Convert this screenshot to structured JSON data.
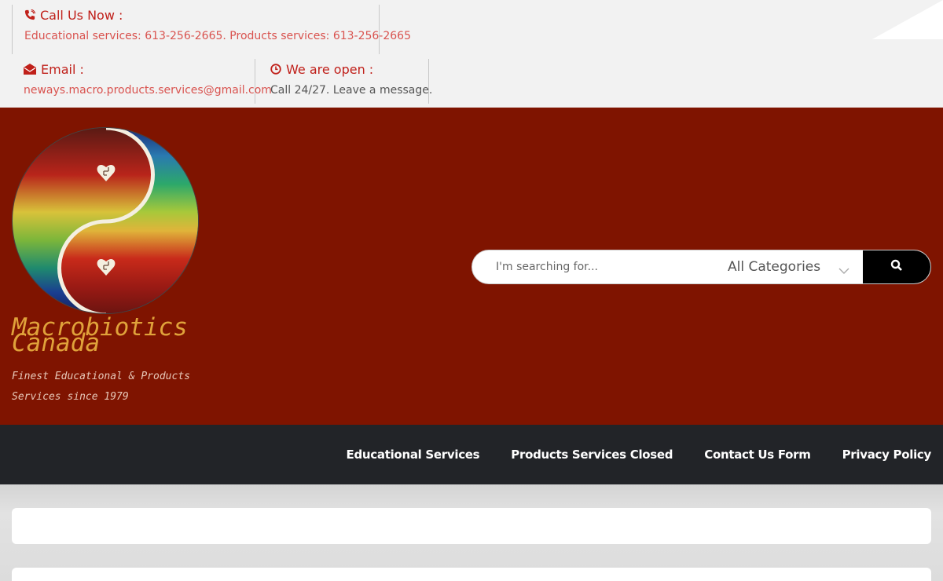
{
  "topbar": {
    "call": {
      "title": "Call Us Now :",
      "text": "Educational services: 613-256-2665. Products services: 613-256-2665",
      "icon": "phone-icon"
    },
    "email": {
      "title": "Email :",
      "text": "neways.macro.products.services@gmail.com",
      "icon": "envelope-icon"
    },
    "hours": {
      "title": "We are open :",
      "text": "Call 24/27. Leave a message.",
      "icon": "clock-icon"
    }
  },
  "header": {
    "title_line1": "Macrobiotics",
    "title_line2": "Canada",
    "tagline": "Finest Educational & Products Services since 1979"
  },
  "search": {
    "placeholder": "I'm searching for...",
    "category": "All Categories",
    "button_icon": "search-icon"
  },
  "nav": {
    "items": [
      "Educational Services",
      "Products Services Closed",
      "Contact Us Form",
      "Privacy Policy"
    ]
  },
  "colors": {
    "accent": "#c0201a",
    "header_bg": "#7f1400",
    "nav_bg": "#222428",
    "title": "#e0a23a"
  }
}
